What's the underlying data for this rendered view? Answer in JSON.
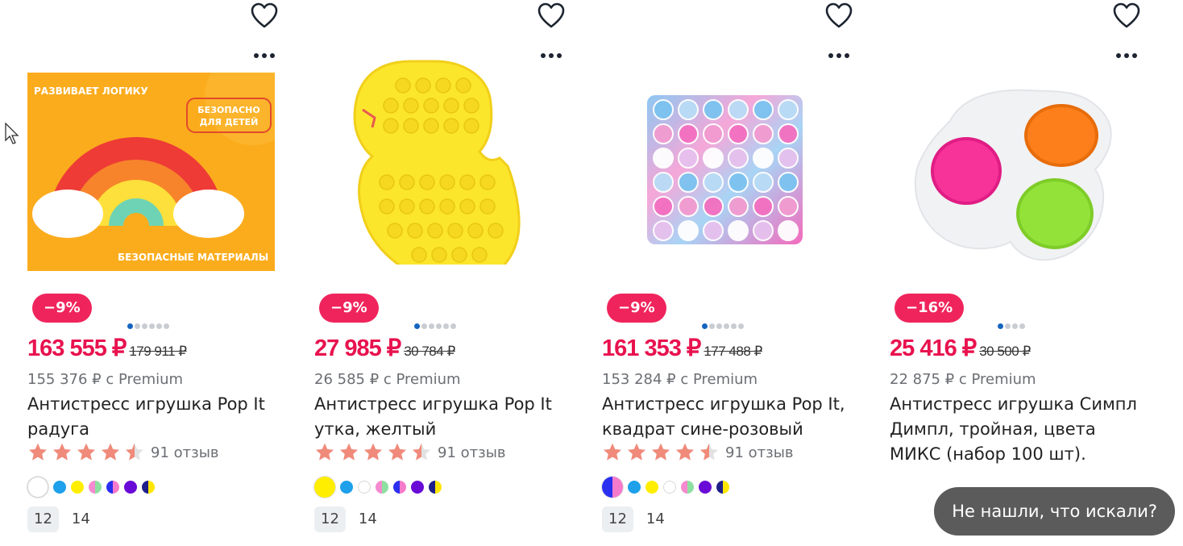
{
  "products": [
    {
      "discount": "−9%",
      "price": "163 555 ₽",
      "old_price": "179 911 ₽",
      "premium": "155 376 ₽ с Premium",
      "title": "Антистресс игрушка Pop It радуга",
      "rating": 4.5,
      "reviews": "91 отзыв",
      "image_texts": {
        "top": "РАЗВИВАЕТ ЛОГИКУ",
        "safe": "БЕЗОПАСНО ДЛЯ ДЕТЕЙ",
        "bottom": "БЕЗОПАСНЫЕ МАТЕРИАЛЫ"
      },
      "photo_count": 6,
      "active_photo": 0,
      "swatches": [
        "#ffffff",
        "#1ea0ea",
        "#ffee00",
        "pink-green",
        "blue-pink",
        "#6a0ad6",
        "yellow-navy"
      ],
      "sizes": [
        "12",
        "14"
      ],
      "selected_size": "12"
    },
    {
      "discount": "−9%",
      "price": "27 985 ₽",
      "old_price": "30 784 ₽",
      "premium": "26 585 ₽ с Premium",
      "title": "Антистресс игрушка Pop It утка, желтый",
      "rating": 4.5,
      "reviews": "91 отзыв",
      "photo_count": 6,
      "active_photo": 0,
      "swatches": [
        "#ffee00",
        "#1ea0ea",
        "#ffffff",
        "pink-green",
        "blue-pink",
        "#6a0ad6",
        "yellow-navy"
      ],
      "sizes": [
        "12",
        "14"
      ],
      "selected_size": "12"
    },
    {
      "discount": "−9%",
      "price": "161 353 ₽",
      "old_price": "177 488 ₽",
      "premium": "153 284 ₽ с Premium",
      "title": "Антистресс игрушка Pop It, квадрат сине-розовый",
      "rating": 4.5,
      "reviews": "91 отзыв",
      "photo_count": 6,
      "active_photo": 0,
      "swatches": [
        "blue-pink",
        "#1ea0ea",
        "#ffee00",
        "#ffffff",
        "pink-green",
        "#6a0ad6",
        "yellow-navy"
      ],
      "sizes": [
        "12",
        "14"
      ],
      "selected_size": "12"
    },
    {
      "discount": "−16%",
      "price": "25 416 ₽",
      "old_price": "30 500 ₽",
      "premium": "22 875 ₽ с Premium",
      "title": "Антистресс игрушка Симпл Димпл, тройная, цвета МИКС (набор 100 шт).",
      "rating": null,
      "reviews": "",
      "photo_count": 4,
      "active_photo": 0,
      "swatches": [],
      "sizes": [],
      "selected_size": ""
    }
  ],
  "chat_button": "Не нашли, что искали?",
  "colors": {
    "accent": "#e8124e",
    "badge": "#f0245c",
    "star": "#f08a7a",
    "active_dot": "#1565c0"
  },
  "icons": {
    "favorite": "heart-icon",
    "menu": "more-dots-icon",
    "rating": "star-icon"
  }
}
